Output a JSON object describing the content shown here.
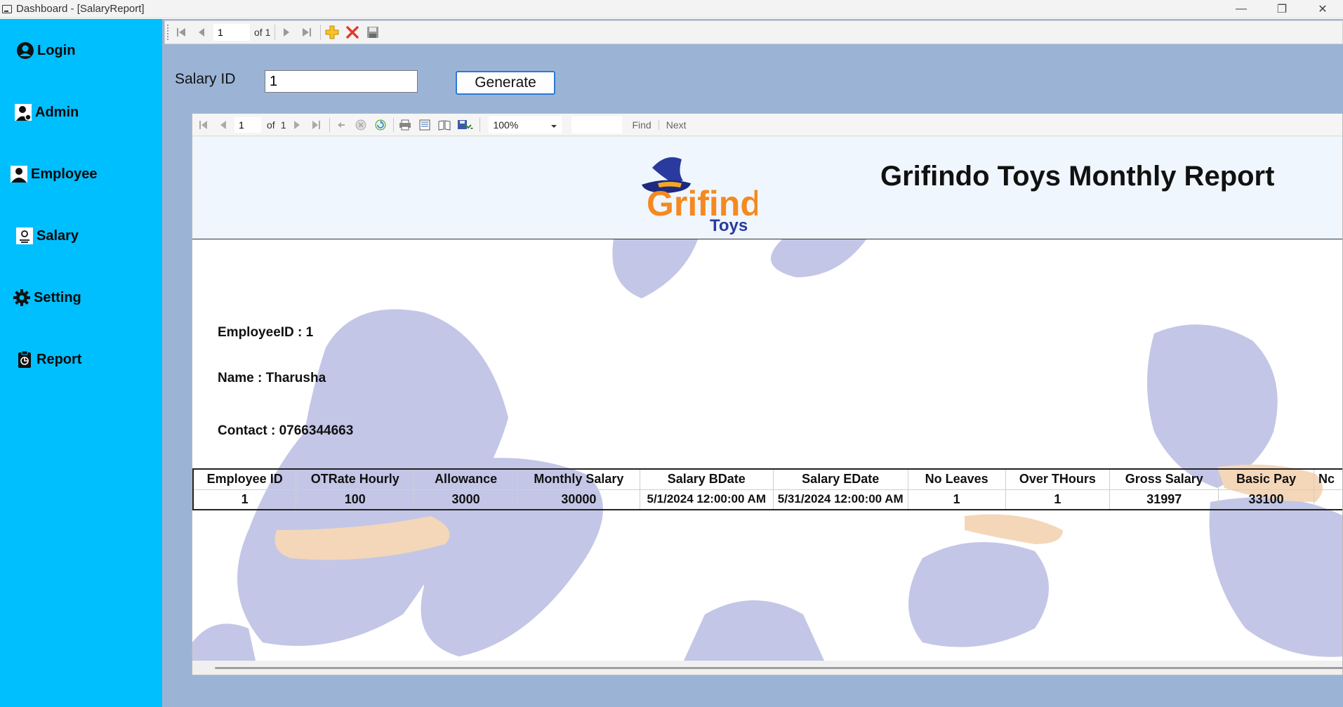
{
  "window": {
    "title": "Dashboard - [SalaryReport]",
    "minimize": "—",
    "maximize": "❐",
    "close": "✕"
  },
  "sidebar": {
    "items": [
      {
        "label": "Login",
        "icon": "user-circle-icon"
      },
      {
        "label": "Admin",
        "icon": "admin-icon"
      },
      {
        "label": "Employee",
        "icon": "employee-icon"
      },
      {
        "label": "Salary",
        "icon": "salary-icon"
      },
      {
        "label": "Setting",
        "icon": "gear-icon"
      },
      {
        "label": "Report",
        "icon": "report-icon"
      }
    ]
  },
  "binding_nav": {
    "position": "1",
    "count": "of 1"
  },
  "form": {
    "salary_id_label": "Salary ID",
    "salary_id_value": "1",
    "generate_label": "Generate"
  },
  "viewer_toolbar": {
    "page": "1",
    "of_pages": "of",
    "total_pages": "1",
    "zoom": "100%",
    "find": "Find",
    "next": "Next"
  },
  "report": {
    "title": "Grifindo Toys Monthly Report",
    "logo_text_main": "Grifindo",
    "logo_text_sub": "Toys",
    "employee_id": "EmployeeID : 1",
    "name": "Name : Tharusha",
    "contact": "Contact : 0766344663",
    "table": {
      "headers": [
        "Employee ID",
        "OTRate Hourly",
        "Allowance",
        "Monthly Salary",
        "Salary BDate",
        "Salary EDate",
        "No Leaves",
        "Over THours",
        "Gross Salary",
        "Basic Pay",
        "Nc"
      ],
      "rows": [
        [
          "1",
          "100",
          "3000",
          "30000",
          "5/1/2024 12:00:00 AM",
          "5/31/2024 12:00:00 AM",
          "1",
          "1",
          "31997",
          "33100",
          ""
        ]
      ]
    }
  },
  "colors": {
    "sidebar": "#00bfff",
    "main_bg": "#9bb4d6",
    "watermark": "#c3c6e6",
    "accent_orange": "#f5891f",
    "hat_blue": "#2b3a9e"
  }
}
